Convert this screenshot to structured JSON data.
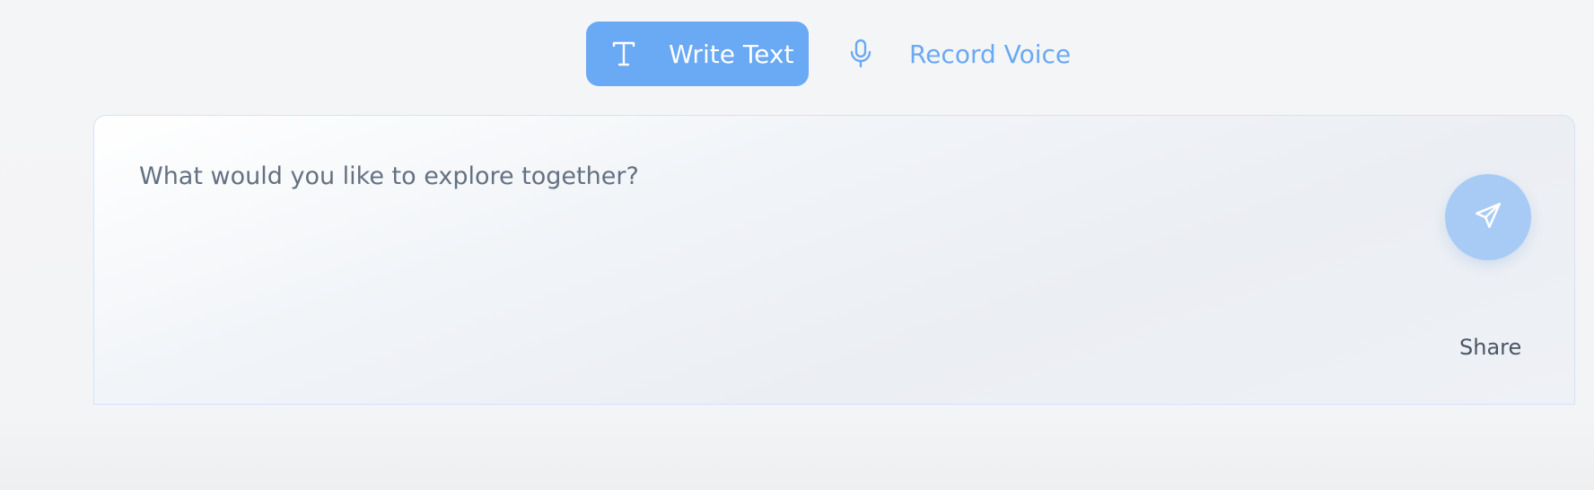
{
  "mode_toggle": {
    "write_text": {
      "label": "Write Text",
      "icon": "text-t-icon",
      "active": true
    },
    "record_voice": {
      "label": "Record Voice",
      "icon": "microphone-icon",
      "active": false
    }
  },
  "composer": {
    "placeholder": "What would you like to explore together?",
    "value": "",
    "send_icon": "send-paper-plane-icon",
    "share_label": "Share"
  },
  "colors": {
    "accent": "#6aa9f4",
    "send_button": "#a8cbf5",
    "placeholder_text": "#647182",
    "border": "#d3e3f7"
  }
}
